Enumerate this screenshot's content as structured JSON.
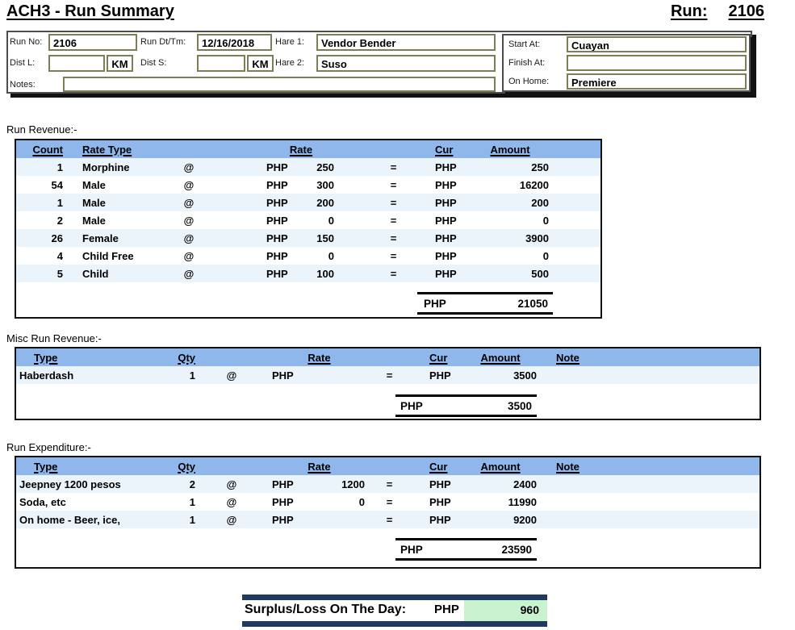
{
  "title": "ACH3 - Run Summary",
  "run_ref": {
    "label": "Run:",
    "value": "2106"
  },
  "symbols": {
    "at": "@",
    "equals": "="
  },
  "colors": {
    "table_header_blue": "#8FB7EB",
    "alt_row_blue": "#EBF3FB",
    "navy_bar": "#20395F",
    "surplus_green": "#C9F2CF",
    "field_border_olive": "#7E7D55"
  },
  "header": {
    "run_no_label": "Run No:",
    "run_no": "2106",
    "run_dt_label": "Run Dt/Tm:",
    "run_dt": "12/16/2018",
    "hare1_label": "Hare 1:",
    "hare1": "Vendor Bender",
    "dist_l_label": "Dist L:",
    "dist_l": "",
    "km1": "KM",
    "dist_s_label": "Dist S:",
    "dist_s": "",
    "km2": "KM",
    "hare2_label": "Hare 2:",
    "hare2": "Suso",
    "notes_label": "Notes:",
    "notes": "",
    "start_at_label": "Start At:",
    "start_at": "Cuayan",
    "finish_at_label": "Finish At:",
    "finish_at": "",
    "on_home_label": "On Home:",
    "on_home": "Premiere"
  },
  "revenue": {
    "section_label": "Run Revenue:-",
    "headers": {
      "count": "Count",
      "rate_type": "Rate Type",
      "rate": "Rate",
      "cur": "Cur",
      "amount": "Amount"
    },
    "rows": [
      {
        "count": "1",
        "rate_type": "Morphine",
        "rate_cur": "PHP",
        "rate": "250",
        "cur": "PHP",
        "amount": "250"
      },
      {
        "count": "54",
        "rate_type": "Male",
        "rate_cur": "PHP",
        "rate": "300",
        "cur": "PHP",
        "amount": "16200"
      },
      {
        "count": "1",
        "rate_type": "Male",
        "rate_cur": "PHP",
        "rate": "200",
        "cur": "PHP",
        "amount": "200"
      },
      {
        "count": "2",
        "rate_type": "Male",
        "rate_cur": "PHP",
        "rate": "0",
        "cur": "PHP",
        "amount": "0"
      },
      {
        "count": "26",
        "rate_type": "Female",
        "rate_cur": "PHP",
        "rate": "150",
        "cur": "PHP",
        "amount": "3900"
      },
      {
        "count": "4",
        "rate_type": "Child Free",
        "rate_cur": "PHP",
        "rate": "0",
        "cur": "PHP",
        "amount": "0"
      },
      {
        "count": "5",
        "rate_type": "Child",
        "rate_cur": "PHP",
        "rate": "100",
        "cur": "PHP",
        "amount": "500"
      }
    ],
    "total": {
      "cur": "PHP",
      "amount": "21050"
    }
  },
  "misc": {
    "section_label": "Misc Run Revenue:-",
    "headers": {
      "type": "Type",
      "qty": "Qty",
      "rate": "Rate",
      "cur": "Cur",
      "amount": "Amount",
      "note": "Note"
    },
    "rows": [
      {
        "type": "Haberdash",
        "qty": "1",
        "rate_cur": "PHP",
        "rate": "",
        "cur": "PHP",
        "amount": "3500",
        "note": ""
      }
    ],
    "total": {
      "cur": "PHP",
      "amount": "3500"
    }
  },
  "expenditure": {
    "section_label": "Run Expenditure:-",
    "headers": {
      "type": "Type",
      "qty": "Qty",
      "rate": "Rate",
      "cur": "Cur",
      "amount": "Amount",
      "note": "Note"
    },
    "rows": [
      {
        "type": "Jeepney 1200 pesos",
        "qty": "2",
        "rate_cur": "PHP",
        "rate": "1200",
        "cur": "PHP",
        "amount": "2400",
        "note": ""
      },
      {
        "type": "Soda, etc",
        "qty": "1",
        "rate_cur": "PHP",
        "rate": "0",
        "cur": "PHP",
        "amount": "11990",
        "note": ""
      },
      {
        "type": "On home - Beer, ice,",
        "qty": "1",
        "rate_cur": "PHP",
        "rate": "",
        "cur": "PHP",
        "amount": "9200",
        "note": ""
      }
    ],
    "total": {
      "cur": "PHP",
      "amount": "23590"
    }
  },
  "surplus": {
    "label": "Surplus/Loss On The Day:",
    "cur": "PHP",
    "amount": "960"
  }
}
